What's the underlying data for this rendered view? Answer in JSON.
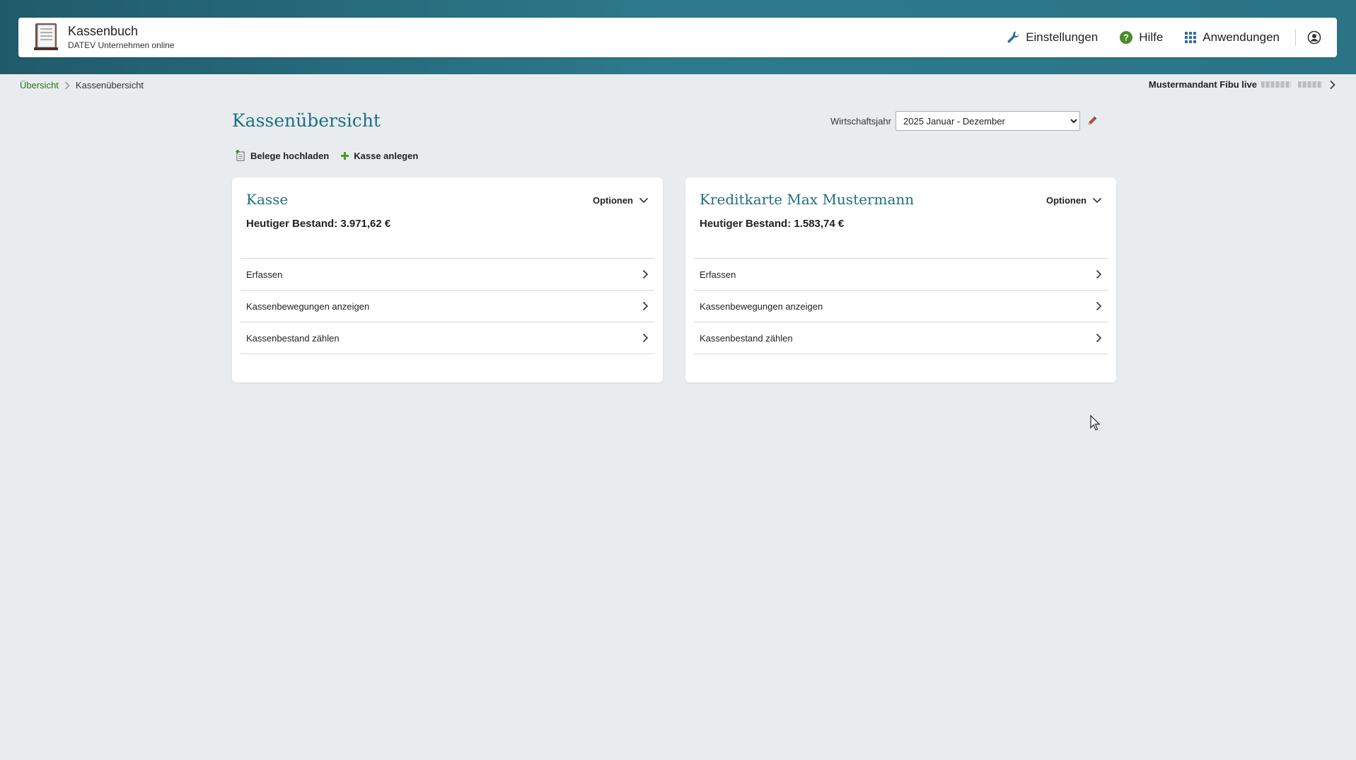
{
  "app": {
    "title": "Kassenbuch",
    "subtitle": "DATEV Unternehmen online"
  },
  "nav": {
    "settings": "Einstellungen",
    "help": "Hilfe",
    "apps": "Anwendungen"
  },
  "breadcrumb": {
    "home": "Übersicht",
    "current": "Kassenübersicht"
  },
  "mandant": {
    "name": "Mustermandant Fibu live"
  },
  "page": {
    "title": "Kassenübersicht"
  },
  "fiscal_year": {
    "label": "Wirtschaftsjahr",
    "selected": "2025 Januar - Dezember"
  },
  "actions": {
    "upload": "Belege hochladen",
    "create": "Kasse anlegen"
  },
  "cards": [
    {
      "title": "Kasse",
      "options": "Optionen",
      "balance": "Heutiger Bestand: 3.971,62 €",
      "rows": [
        "Erfassen",
        "Kassenbewegungen anzeigen",
        "Kassenbestand zählen"
      ]
    },
    {
      "title": "Kreditkarte Max Mustermann",
      "options": "Optionen",
      "balance": "Heutiger Bestand: 1.583,74 €",
      "rows": [
        "Erfassen",
        "Kassenbewegungen anzeigen",
        "Kassenbestand zählen"
      ]
    }
  ],
  "colors": {
    "accent": "#1f6f80",
    "link": "#2e6f1f",
    "band": "#2a7486",
    "background": "#e8ecef"
  }
}
